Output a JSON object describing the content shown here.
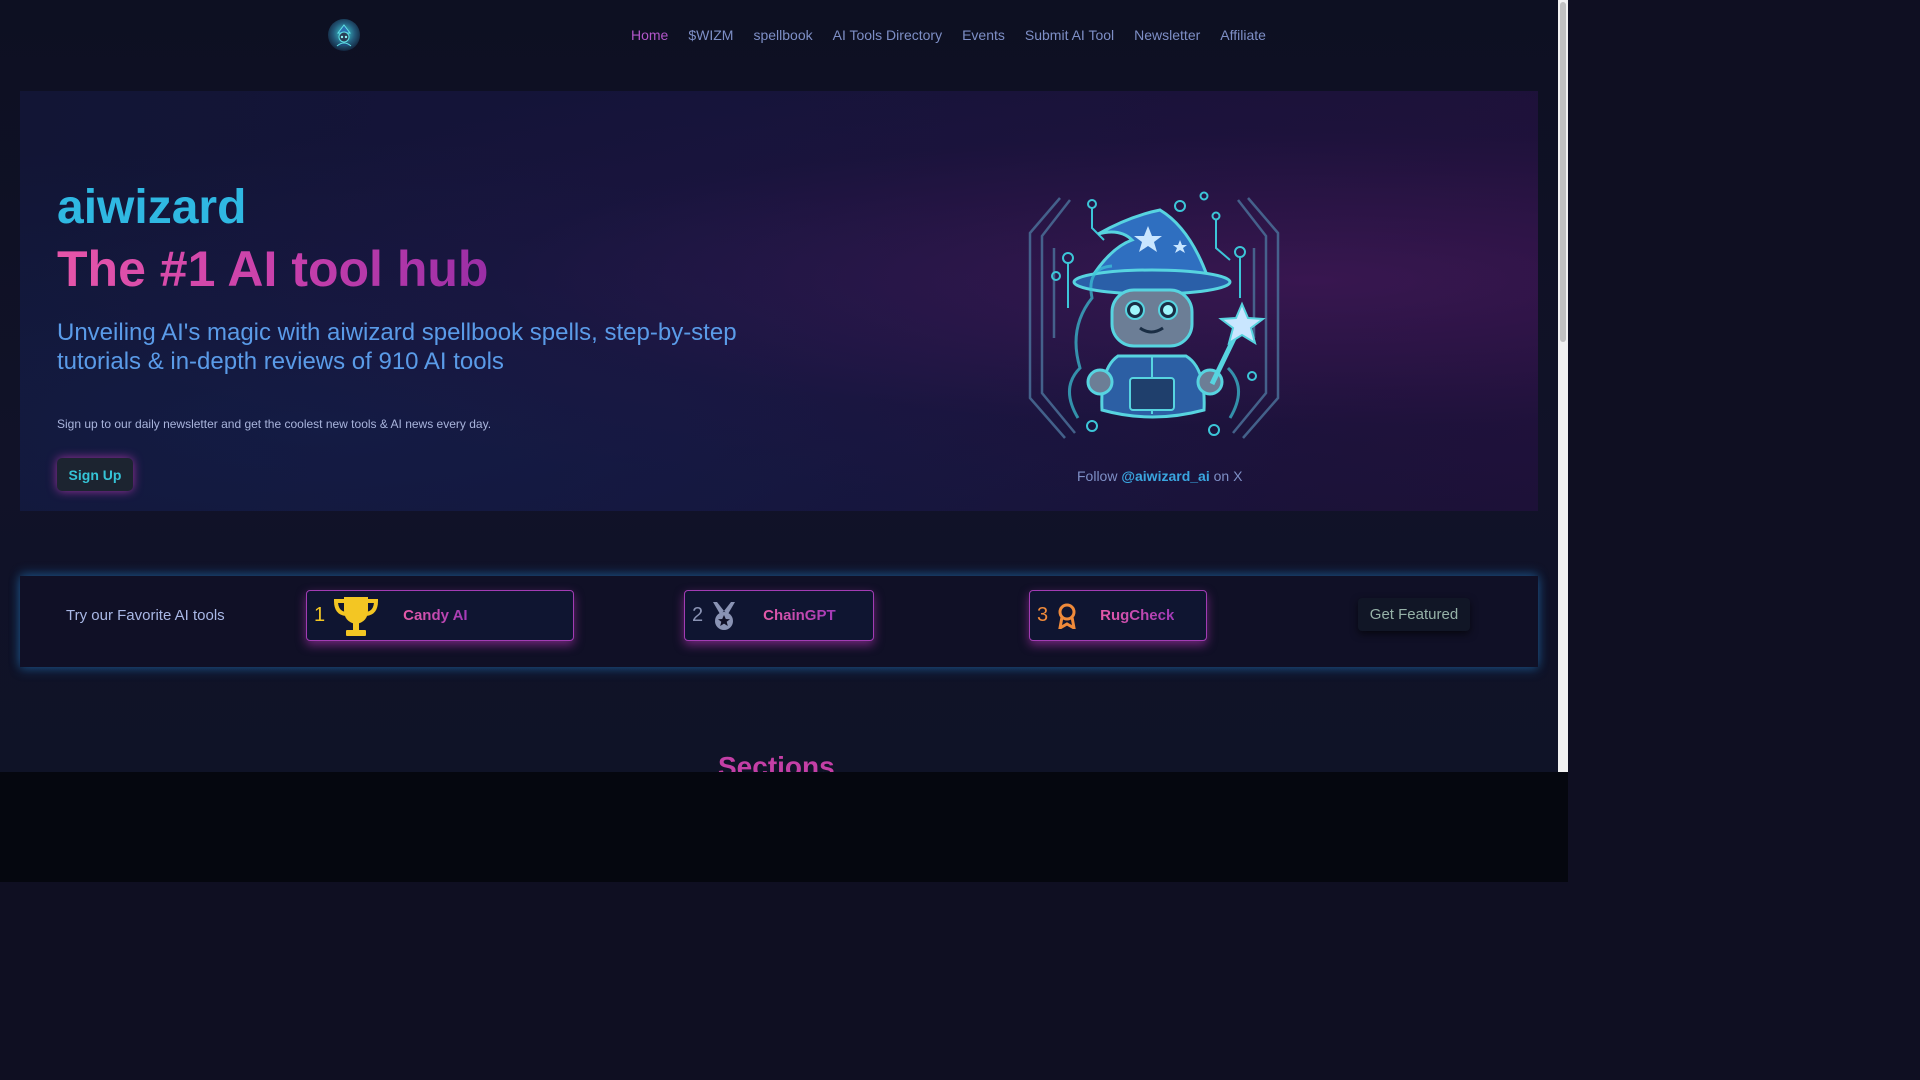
{
  "nav": {
    "logo_alt": "aiwizard logo",
    "items": [
      {
        "label": "Home",
        "active": true
      },
      {
        "label": "$WIZM",
        "active": false
      },
      {
        "label": "spellbook",
        "active": false
      },
      {
        "label": "AI Tools Directory",
        "active": false
      },
      {
        "label": "Events",
        "active": false
      },
      {
        "label": "Submit AI Tool",
        "active": false
      },
      {
        "label": "Newsletter",
        "active": false
      },
      {
        "label": "Affiliate",
        "active": false
      }
    ]
  },
  "hero": {
    "brand": "aiwizard",
    "title": "The #1 AI tool hub",
    "subtitle": "Unveiling AI's magic with aiwizard spellbook spells, step-by-step tutorials & in-depth reviews of 910 AI tools",
    "note": "Sign up to our daily newsletter and get the coolest new tools & AI news every day.",
    "signup_label": "Sign Up",
    "follow_prefix": "Follow",
    "follow_handle": "@aiwizard_ai",
    "follow_suffix": "on X",
    "mascot_icon": "wizard-robot-icon"
  },
  "favorites": {
    "label": "Try our Favorite AI tools",
    "items": [
      {
        "rank": "1",
        "name": "Candy AI",
        "icon": "trophy-icon",
        "color": "#f3c623"
      },
      {
        "rank": "2",
        "name": "ChainGPT",
        "icon": "medal-icon",
        "color": "#8a93b4"
      },
      {
        "rank": "3",
        "name": "RugCheck",
        "icon": "award-ribbon-icon",
        "color": "#ef8a3a"
      }
    ],
    "cta_label": "Get Featured"
  },
  "sections": {
    "heading": "Sections"
  },
  "colors": {
    "accent_pink": "#c63fab",
    "accent_cyan": "#2fb8e2",
    "nav_active": "#b256c9",
    "nav_text": "#7e8fc6"
  }
}
